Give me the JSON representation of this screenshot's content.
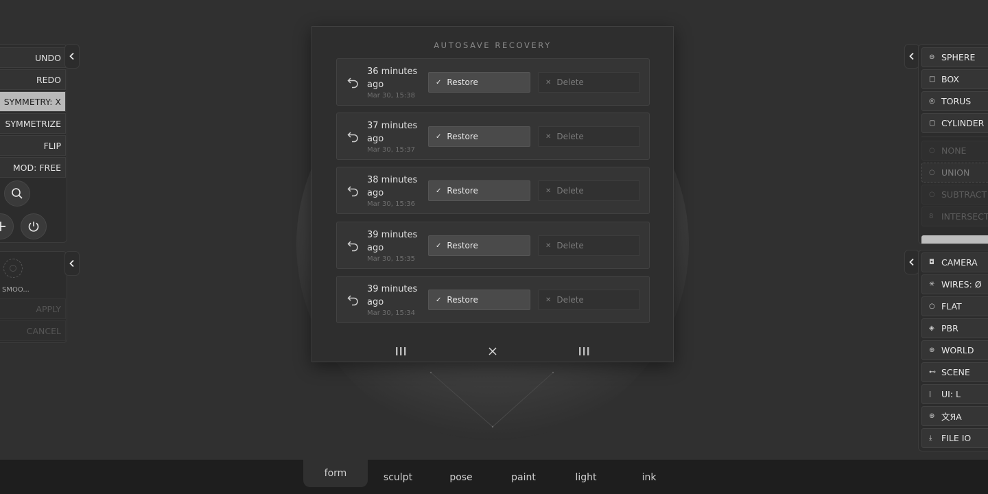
{
  "left_toolbar": {
    "items": [
      {
        "label": "UNDO",
        "active": false
      },
      {
        "label": "REDO",
        "active": false
      },
      {
        "label": "SYMMETRY: X",
        "active": true
      },
      {
        "label": "SYMMETRIZE",
        "active": false
      },
      {
        "label": "FLIP",
        "active": false
      },
      {
        "label": "MOD: FREE",
        "active": false
      }
    ],
    "round_icons": [
      "search-icon",
      "plus-icon",
      "power-icon"
    ],
    "secondary": {
      "label": "SMOO...",
      "apply": "APPLY",
      "cancel": "CANCEL"
    }
  },
  "modal": {
    "title": "AUTOSAVE RECOVERY",
    "restore_label": "Restore",
    "delete_label": "Delete",
    "entries": [
      {
        "when": "36 minutes ago",
        "date": "Mar 30, 15:38"
      },
      {
        "when": "37 minutes ago",
        "date": "Mar 30, 15:37"
      },
      {
        "when": "38 minutes ago",
        "date": "Mar 30, 15:36"
      },
      {
        "when": "39 minutes ago",
        "date": "Mar 30, 15:35"
      },
      {
        "when": "39 minutes ago",
        "date": "Mar 30, 15:34"
      }
    ],
    "footer_icons": [
      "grip-left-icon",
      "close-icon",
      "grip-right-icon"
    ]
  },
  "right_toolbar": {
    "primitives": [
      {
        "label": "SPHERE",
        "icon": "⊖"
      },
      {
        "label": "BOX",
        "icon": "□"
      },
      {
        "label": "TORUS",
        "icon": "◎"
      },
      {
        "label": "CYLINDER",
        "icon": "▢"
      }
    ],
    "boolean": [
      {
        "label": "NONE",
        "icon": "○",
        "state": "dim"
      },
      {
        "label": "UNION",
        "icon": "○",
        "state": "dashed"
      },
      {
        "label": "SUBTRACT",
        "icon": "○",
        "state": "dim"
      },
      {
        "label": "INTERSECT",
        "icon": "8",
        "state": "dim"
      }
    ],
    "view": [
      {
        "label": "CAMERA",
        "icon": "◘"
      },
      {
        "label": "WIRES: Ø",
        "icon": "✳"
      },
      {
        "label": "FLAT",
        "icon": "○"
      },
      {
        "label": "PBR",
        "icon": "◈"
      },
      {
        "label": "WORLD",
        "icon": "⊕"
      },
      {
        "label": "SCENE",
        "icon": "⊷"
      },
      {
        "label": "UI: L",
        "icon": "ǀ"
      },
      {
        "label": "文ЯA",
        "icon": "⊕"
      },
      {
        "label": "FILE IO",
        "icon": "⤓"
      }
    ]
  },
  "tabs": [
    {
      "label": "form",
      "active": true
    },
    {
      "label": "sculpt",
      "active": false
    },
    {
      "label": "pose",
      "active": false
    },
    {
      "label": "paint",
      "active": false
    },
    {
      "label": "light",
      "active": false
    },
    {
      "label": "ink",
      "active": false
    }
  ],
  "colors": {
    "background": "#303030",
    "panel": "#2c2c2c",
    "active_button": "#b9b9b9",
    "restore_button": "#4a4a4a",
    "tab_bar": "#1e1e1e"
  }
}
